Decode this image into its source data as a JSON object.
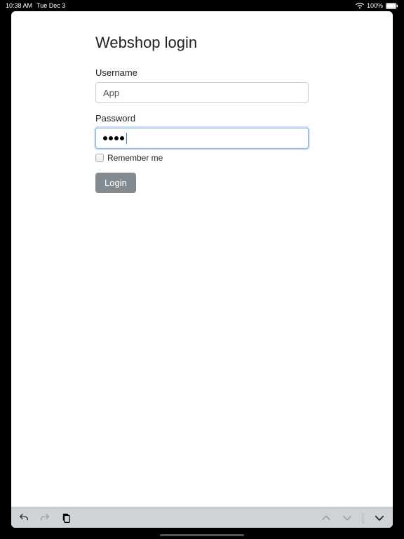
{
  "statusbar": {
    "time": "10:38 AM",
    "date": "Tue Dec 3",
    "battery_pct": "100%"
  },
  "login": {
    "title": "Webshop login",
    "username_label": "Username",
    "username_value": "App",
    "password_label": "Password",
    "password_masked_length": 4,
    "remember_label": "Remember me",
    "login_button": "Login"
  }
}
